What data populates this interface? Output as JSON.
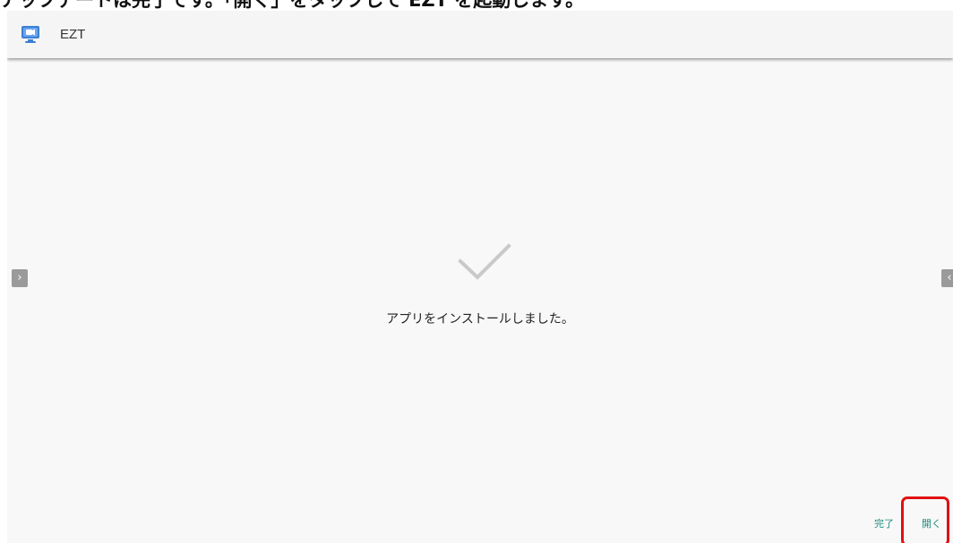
{
  "caption": "アップデートは完了です。「開く」をタップして EZT を起動します。",
  "app": {
    "name": "EZT",
    "icon": "monitor-app-icon"
  },
  "nav": {
    "prev_icon": "chevron-right-icon",
    "next_icon": "chevron-left-icon"
  },
  "status": {
    "icon": "checkmark-icon",
    "message": "アプリをインストールしました。"
  },
  "actions": {
    "done_label": "完了",
    "open_label": "開く"
  },
  "colors": {
    "accent": "#1e8a7e",
    "highlight": "#e01010",
    "background": "#f8f8f8"
  }
}
